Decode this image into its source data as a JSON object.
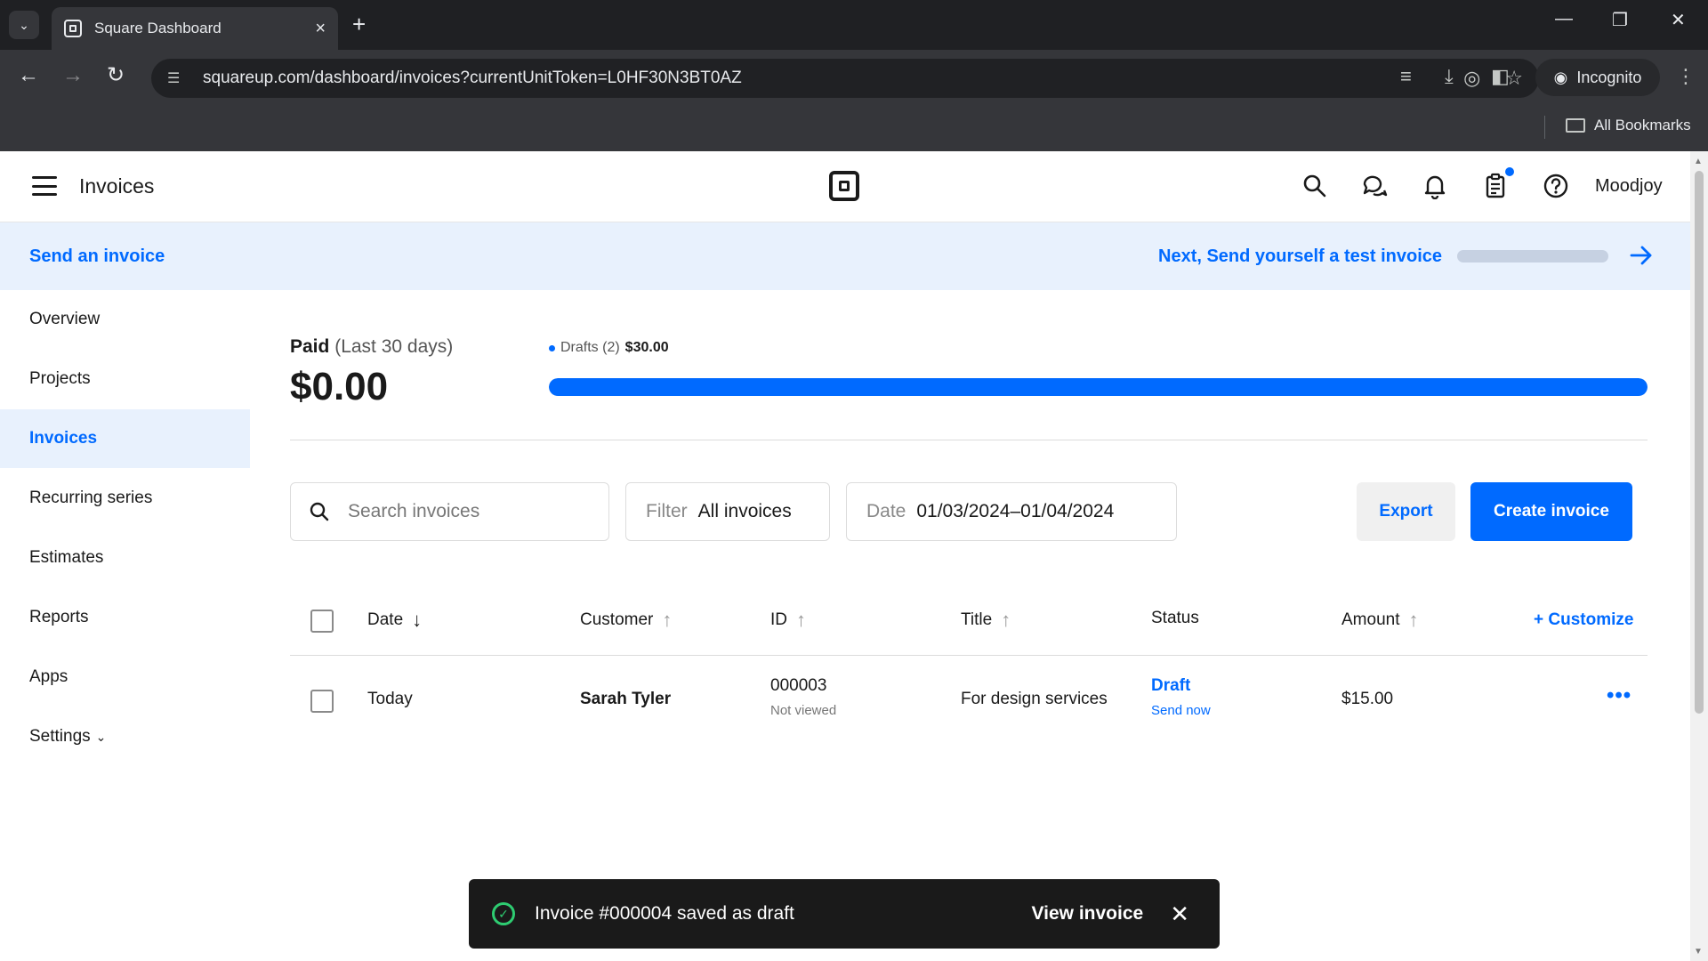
{
  "browser": {
    "tab_title": "Square Dashboard",
    "url": "squareup.com/dashboard/invoices?currentUnitToken=L0HF30N3BT0AZ",
    "profile_label": "Incognito",
    "bookmarks_label": "All Bookmarks"
  },
  "header": {
    "title": "Invoices",
    "user_name": "Moodjoy"
  },
  "banner": {
    "left_link": "Send an invoice",
    "next_step": "Next, Send yourself a test invoice"
  },
  "sidebar": {
    "items": [
      {
        "label": "Overview"
      },
      {
        "label": "Projects"
      },
      {
        "label": "Invoices"
      },
      {
        "label": "Recurring series"
      },
      {
        "label": "Estimates"
      },
      {
        "label": "Reports"
      },
      {
        "label": "Apps"
      },
      {
        "label": "Settings"
      }
    ]
  },
  "summary": {
    "paid_label": "Paid",
    "paid_period": "(Last 30 days)",
    "paid_amount": "$0.00",
    "drafts_label": "Drafts (2)",
    "drafts_amount": "$30.00",
    "drafts_fraction": 1.0
  },
  "controls": {
    "search_placeholder": "Search invoices",
    "filter_label": "Filter",
    "filter_value": "All invoices",
    "date_label": "Date",
    "date_value": "01/03/2024–01/04/2024",
    "export_label": "Export",
    "create_label": "Create invoice"
  },
  "table": {
    "columns": [
      "Date",
      "Customer",
      "ID",
      "Title",
      "Status",
      "Amount"
    ],
    "customize_label": "+ Customize",
    "rows": [
      {
        "date": "Today",
        "customer": "Sarah Tyler",
        "id": "000003",
        "id_sub": "Not viewed",
        "title": "For design services",
        "status": "Draft",
        "status_action": "Send now",
        "amount": "$15.00",
        "more": "•••"
      }
    ]
  },
  "toast": {
    "message": "Invoice #000004 saved as draft",
    "action": "View invoice"
  },
  "colors": {
    "accent": "#006aff",
    "toast_bg": "#1a1a1a",
    "success": "#2ecc71"
  }
}
